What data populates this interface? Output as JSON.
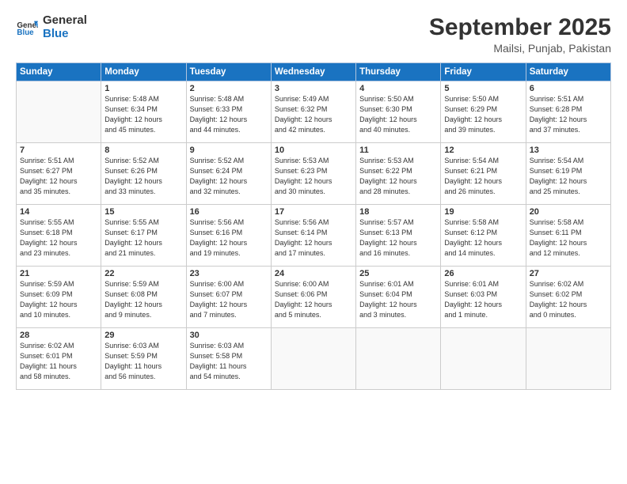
{
  "header": {
    "logo_line1": "General",
    "logo_line2": "Blue",
    "month": "September 2025",
    "location": "Mailsi, Punjab, Pakistan"
  },
  "weekdays": [
    "Sunday",
    "Monday",
    "Tuesday",
    "Wednesday",
    "Thursday",
    "Friday",
    "Saturday"
  ],
  "weeks": [
    [
      {
        "day": "",
        "info": ""
      },
      {
        "day": "1",
        "info": "Sunrise: 5:48 AM\nSunset: 6:34 PM\nDaylight: 12 hours\nand 45 minutes."
      },
      {
        "day": "2",
        "info": "Sunrise: 5:48 AM\nSunset: 6:33 PM\nDaylight: 12 hours\nand 44 minutes."
      },
      {
        "day": "3",
        "info": "Sunrise: 5:49 AM\nSunset: 6:32 PM\nDaylight: 12 hours\nand 42 minutes."
      },
      {
        "day": "4",
        "info": "Sunrise: 5:50 AM\nSunset: 6:30 PM\nDaylight: 12 hours\nand 40 minutes."
      },
      {
        "day": "5",
        "info": "Sunrise: 5:50 AM\nSunset: 6:29 PM\nDaylight: 12 hours\nand 39 minutes."
      },
      {
        "day": "6",
        "info": "Sunrise: 5:51 AM\nSunset: 6:28 PM\nDaylight: 12 hours\nand 37 minutes."
      }
    ],
    [
      {
        "day": "7",
        "info": "Sunrise: 5:51 AM\nSunset: 6:27 PM\nDaylight: 12 hours\nand 35 minutes."
      },
      {
        "day": "8",
        "info": "Sunrise: 5:52 AM\nSunset: 6:26 PM\nDaylight: 12 hours\nand 33 minutes."
      },
      {
        "day": "9",
        "info": "Sunrise: 5:52 AM\nSunset: 6:24 PM\nDaylight: 12 hours\nand 32 minutes."
      },
      {
        "day": "10",
        "info": "Sunrise: 5:53 AM\nSunset: 6:23 PM\nDaylight: 12 hours\nand 30 minutes."
      },
      {
        "day": "11",
        "info": "Sunrise: 5:53 AM\nSunset: 6:22 PM\nDaylight: 12 hours\nand 28 minutes."
      },
      {
        "day": "12",
        "info": "Sunrise: 5:54 AM\nSunset: 6:21 PM\nDaylight: 12 hours\nand 26 minutes."
      },
      {
        "day": "13",
        "info": "Sunrise: 5:54 AM\nSunset: 6:19 PM\nDaylight: 12 hours\nand 25 minutes."
      }
    ],
    [
      {
        "day": "14",
        "info": "Sunrise: 5:55 AM\nSunset: 6:18 PM\nDaylight: 12 hours\nand 23 minutes."
      },
      {
        "day": "15",
        "info": "Sunrise: 5:55 AM\nSunset: 6:17 PM\nDaylight: 12 hours\nand 21 minutes."
      },
      {
        "day": "16",
        "info": "Sunrise: 5:56 AM\nSunset: 6:16 PM\nDaylight: 12 hours\nand 19 minutes."
      },
      {
        "day": "17",
        "info": "Sunrise: 5:56 AM\nSunset: 6:14 PM\nDaylight: 12 hours\nand 17 minutes."
      },
      {
        "day": "18",
        "info": "Sunrise: 5:57 AM\nSunset: 6:13 PM\nDaylight: 12 hours\nand 16 minutes."
      },
      {
        "day": "19",
        "info": "Sunrise: 5:58 AM\nSunset: 6:12 PM\nDaylight: 12 hours\nand 14 minutes."
      },
      {
        "day": "20",
        "info": "Sunrise: 5:58 AM\nSunset: 6:11 PM\nDaylight: 12 hours\nand 12 minutes."
      }
    ],
    [
      {
        "day": "21",
        "info": "Sunrise: 5:59 AM\nSunset: 6:09 PM\nDaylight: 12 hours\nand 10 minutes."
      },
      {
        "day": "22",
        "info": "Sunrise: 5:59 AM\nSunset: 6:08 PM\nDaylight: 12 hours\nand 9 minutes."
      },
      {
        "day": "23",
        "info": "Sunrise: 6:00 AM\nSunset: 6:07 PM\nDaylight: 12 hours\nand 7 minutes."
      },
      {
        "day": "24",
        "info": "Sunrise: 6:00 AM\nSunset: 6:06 PM\nDaylight: 12 hours\nand 5 minutes."
      },
      {
        "day": "25",
        "info": "Sunrise: 6:01 AM\nSunset: 6:04 PM\nDaylight: 12 hours\nand 3 minutes."
      },
      {
        "day": "26",
        "info": "Sunrise: 6:01 AM\nSunset: 6:03 PM\nDaylight: 12 hours\nand 1 minute."
      },
      {
        "day": "27",
        "info": "Sunrise: 6:02 AM\nSunset: 6:02 PM\nDaylight: 12 hours\nand 0 minutes."
      }
    ],
    [
      {
        "day": "28",
        "info": "Sunrise: 6:02 AM\nSunset: 6:01 PM\nDaylight: 11 hours\nand 58 minutes."
      },
      {
        "day": "29",
        "info": "Sunrise: 6:03 AM\nSunset: 5:59 PM\nDaylight: 11 hours\nand 56 minutes."
      },
      {
        "day": "30",
        "info": "Sunrise: 6:03 AM\nSunset: 5:58 PM\nDaylight: 11 hours\nand 54 minutes."
      },
      {
        "day": "",
        "info": ""
      },
      {
        "day": "",
        "info": ""
      },
      {
        "day": "",
        "info": ""
      },
      {
        "day": "",
        "info": ""
      }
    ]
  ]
}
